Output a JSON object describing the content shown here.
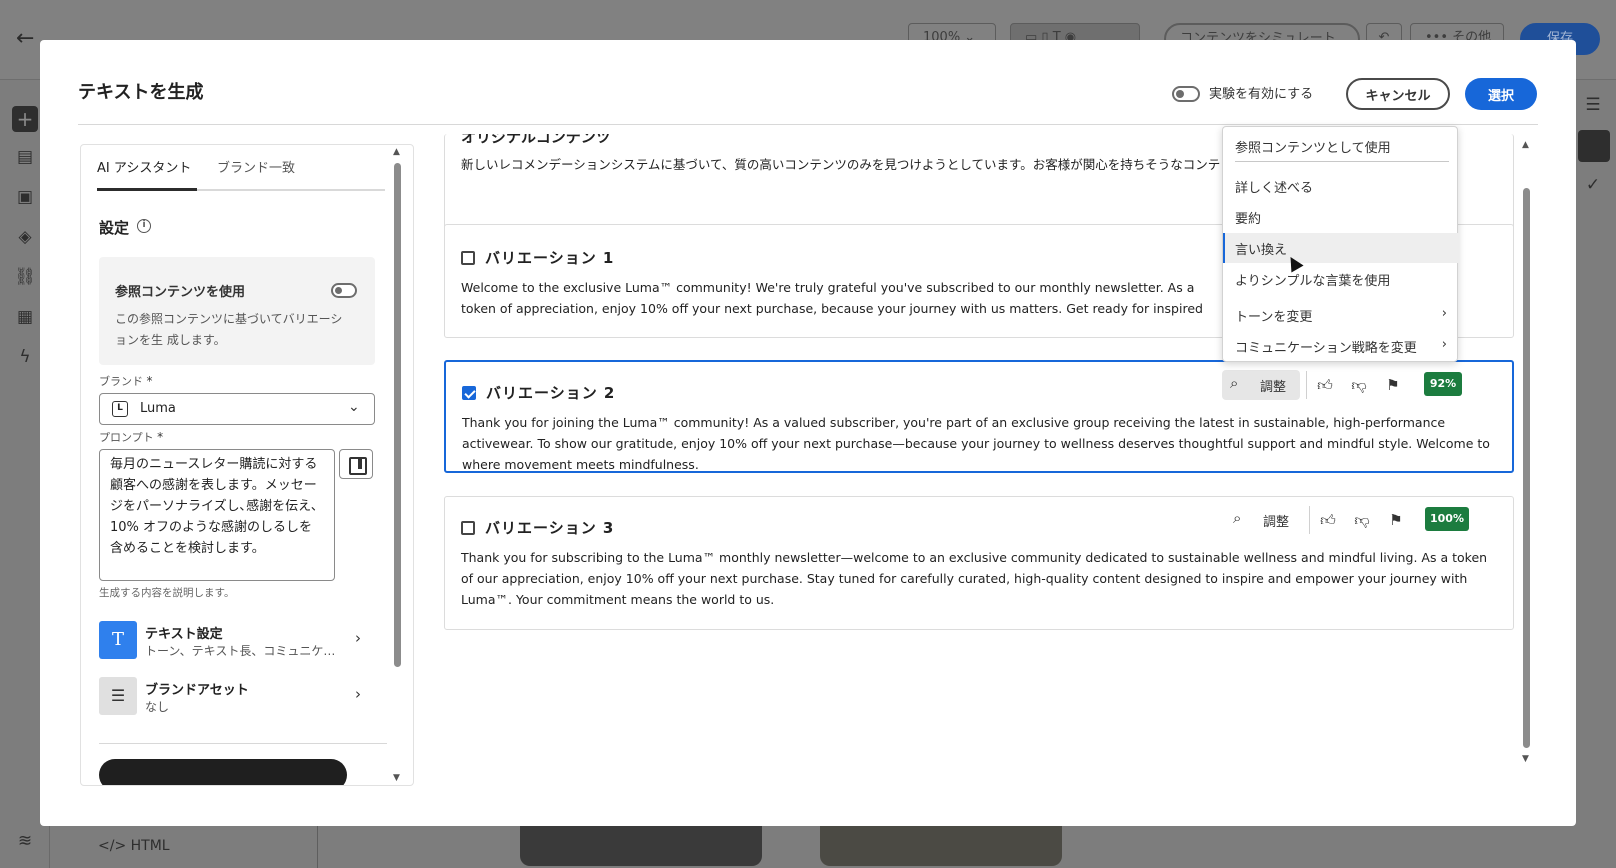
{
  "background": {
    "zoom_value": "100%",
    "simulate_label": "コンテンツをシミュレート",
    "more_label": "その他",
    "save_label": "保存",
    "html_label": "HTML"
  },
  "modal": {
    "title": "テキストを生成",
    "experiment_label": "実験を有効にする",
    "cancel_label": "キャンセル",
    "select_label": "選択"
  },
  "left_panel": {
    "tabs": [
      "AI アシスタント",
      "ブランド一致"
    ],
    "settings_heading": "設定",
    "reference": {
      "title": "参照コンテンツを使用",
      "description": "この参照コンテンツに基づいてバリエーションを生 成します。"
    },
    "brand_label": "ブランド",
    "brand_value": "Luma",
    "prompt_label": "プロンプト",
    "required_mark": "*",
    "prompt_text": "毎月のニュースレター購読に対する顧客への感謝を表します。メッセージをパーソナライズし､感謝を伝え､10% オフのような感謝のしるしを含めることを検討します。",
    "prompt_help": "生成する内容を説明します。",
    "text_settings": {
      "title": "テキスト設定",
      "subtitle": "トーン、テキスト長、コミュニケーション戦略"
    },
    "brand_assets": {
      "title": "ブランドアセット",
      "subtitle": "なし"
    }
  },
  "results": {
    "original": {
      "title": "オリジナルコンテンツ",
      "text": "新しいレコメンデーションシステムに基づいて、質の高いコンテンツのみを見つけようとしています。お客様が関心を持ちそうなコンテンツ"
    },
    "variations": [
      {
        "title": "バリエーション 1",
        "checked": false,
        "text": "Welcome to the exclusive Luma™ community! We're truly grateful you've subscribed to our monthly newsletter. As a token of appreciation, enjoy 10% off your next purchase, because your journey with us matters. Get ready for inspired updates on sustainable, inclusive activewear designed just for you. Stay empowered, stay inspired!"
      },
      {
        "title": "バリエーション 2",
        "checked": true,
        "refine_label": "調整",
        "score": "92%",
        "text": "Thank you for joining the Luma™ community! As a valued subscriber, you're part of an exclusive group receiving the latest in sustainable, high-performance activewear. To show our gratitude, enjoy 10% off your next purchase—because your journey to wellness deserves thoughtful support and mindful style. Welcome to where movement meets mindfulness."
      },
      {
        "title": "バリエーション 3",
        "checked": false,
        "refine_label": "調整",
        "score": "100%",
        "text": "Thank you for subscribing to the Luma™ monthly newsletter—welcome to an exclusive community dedicated to sustainable wellness and mindful living. As a token of our appreciation, enjoy 10% off your next purchase. Stay tuned for carefully curated, high-quality content designed to inspire and empower your journey with Luma™. Your commitment means the world to us."
      }
    ]
  },
  "refine_menu": {
    "items": [
      "参照コンテンツとして使用",
      "詳しく述べる",
      "要約",
      "言い換え",
      "よりシンプルな言葉を使用",
      "トーンを変更",
      "コミュニケーション戦略を変更"
    ],
    "hovered": "言い換え"
  },
  "colors": {
    "accent": "#1767d9",
    "score_green": "#1c7c3f",
    "text_settings_icon": "#2f80ed"
  }
}
